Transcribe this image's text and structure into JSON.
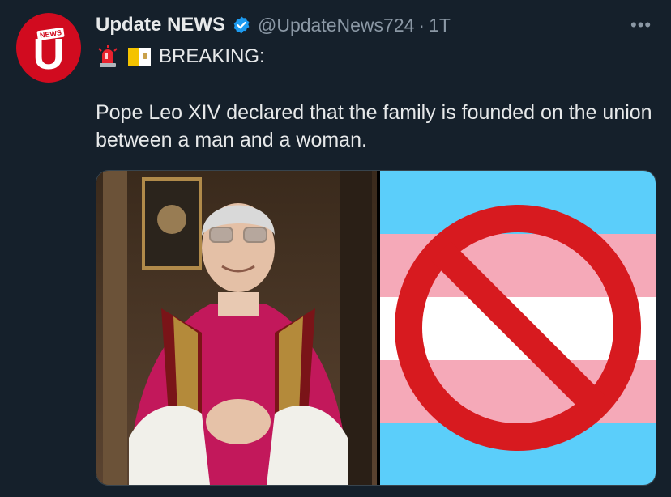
{
  "tweet": {
    "author_name": "Update NEWS",
    "handle": "@UpdateNews724",
    "separator": "·",
    "time": "1T",
    "more_label": "•••",
    "breaking_label": "BREAKING:",
    "text": "Pope Leo XIV declared that the family is founded on the union between a man and a woman.",
    "avatar": {
      "tag": "NEWS",
      "letter": "U"
    }
  },
  "icons": {
    "verified": "verified-badge-icon",
    "siren": "police-siren-emoji",
    "flag": "vatican-flag-emoji",
    "more": "more-options-icon"
  },
  "colors": {
    "background": "#15202b",
    "text": "#e7e9ea",
    "muted": "#8b98a5",
    "verified_blue": "#1d9bf0",
    "avatar_red": "#d10b1f",
    "trans_blue": "#5bcefa",
    "trans_pink": "#f5a9b8",
    "prohibit_red": "#d71a1f"
  }
}
